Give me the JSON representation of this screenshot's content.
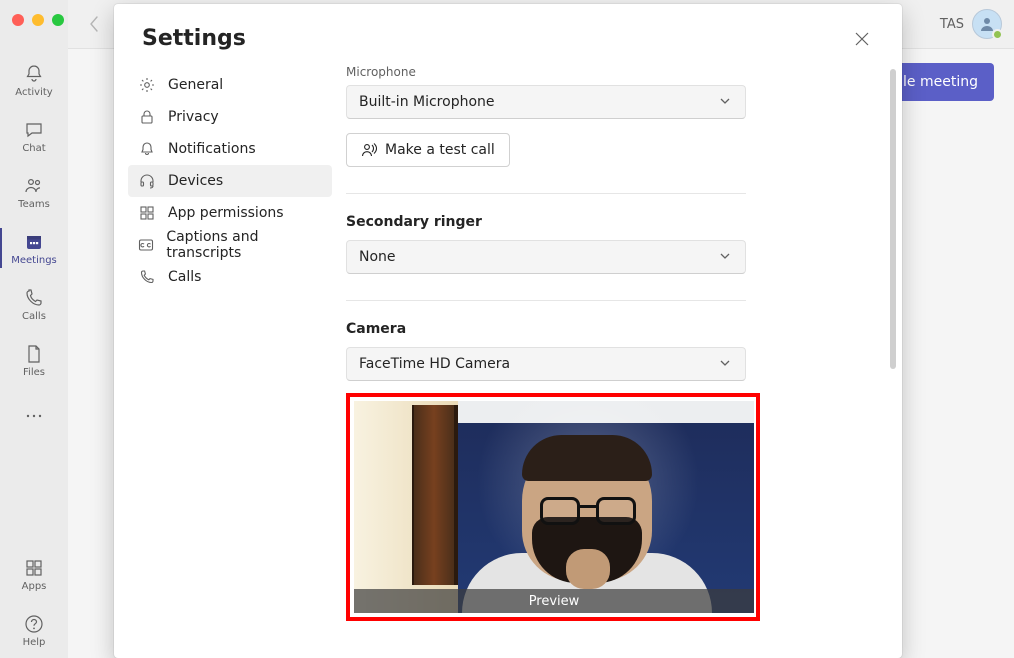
{
  "window": {
    "user_initials": "TAS"
  },
  "header": {
    "schedule_button": "Schedule meeting"
  },
  "rail": {
    "items": [
      {
        "label": "Activity"
      },
      {
        "label": "Chat"
      },
      {
        "label": "Teams"
      },
      {
        "label": "Meetings"
      },
      {
        "label": "Calls"
      },
      {
        "label": "Files"
      }
    ],
    "apps_label": "Apps",
    "help_label": "Help"
  },
  "modal": {
    "title": "Settings",
    "nav": [
      {
        "label": "General"
      },
      {
        "label": "Privacy"
      },
      {
        "label": "Notifications"
      },
      {
        "label": "Devices"
      },
      {
        "label": "App permissions"
      },
      {
        "label": "Captions and transcripts"
      },
      {
        "label": "Calls"
      }
    ],
    "devices": {
      "microphone_label": "Microphone",
      "microphone_value": "Built-in Microphone",
      "test_call_label": "Make a test call",
      "secondary_ringer_label": "Secondary ringer",
      "secondary_ringer_value": "None",
      "camera_label": "Camera",
      "camera_value": "FaceTime HD Camera",
      "preview_label": "Preview"
    }
  }
}
